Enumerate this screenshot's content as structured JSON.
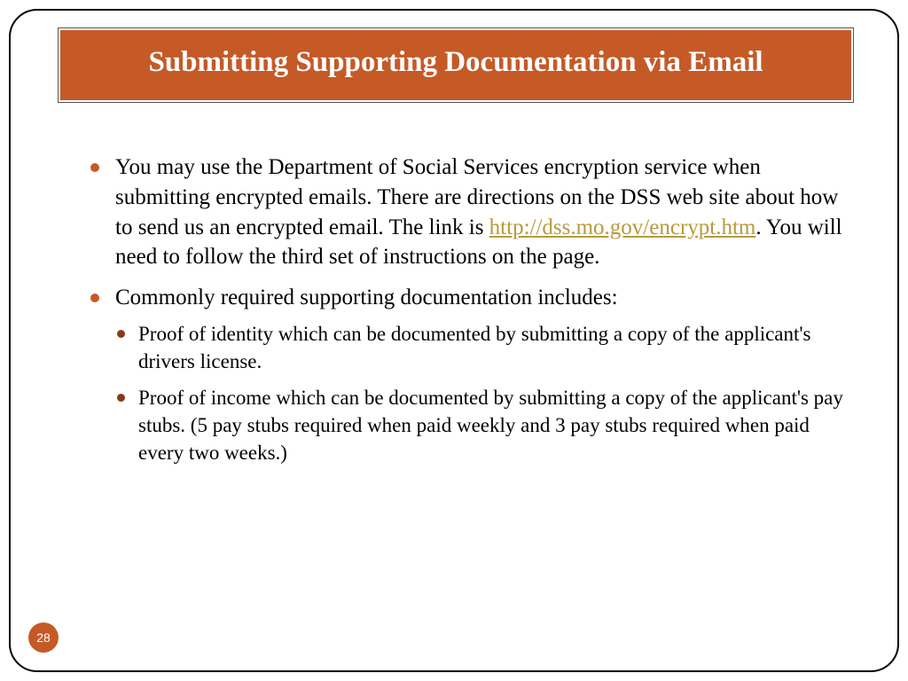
{
  "title": "Submitting Supporting Documentation via Email",
  "bullets": {
    "b1_before": "You may use the Department of Social Services encryption service when submitting encrypted emails.  There are directions on the DSS web site about how to send us an encrypted email.  The link is ",
    "b1_link": "http://dss.mo.gov/encrypt.htm",
    "b1_after": ".   You will need to follow the third set of instructions on the page.",
    "b2": "Commonly required supporting documentation includes:",
    "sub1": "Proof of identity which can be documented by submitting a copy of the applicant's drivers license.",
    "sub2": "Proof of income which can be documented by submitting a copy of the applicant's pay stubs. (5 pay stubs required when paid weekly and 3 pay stubs required when paid every two weeks.)"
  },
  "page_number": "28",
  "colors": {
    "accent": "#c55a27",
    "link": "#b89a3a"
  }
}
